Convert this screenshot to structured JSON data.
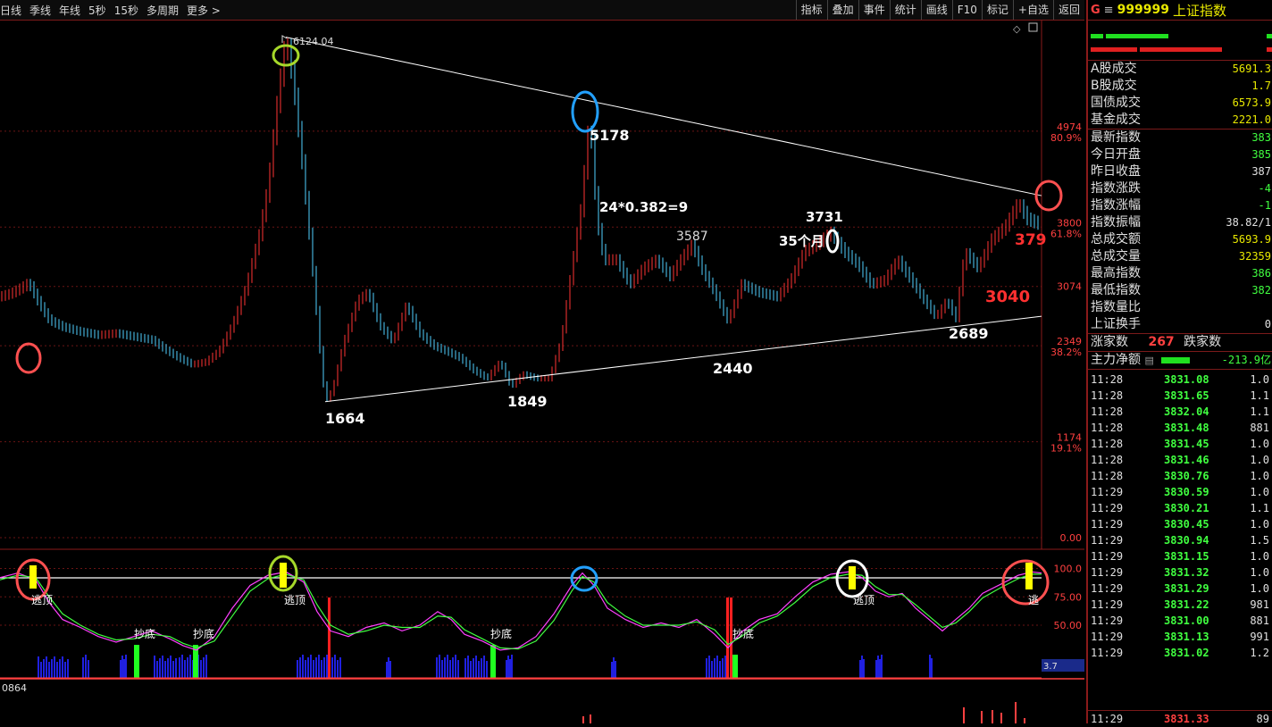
{
  "toolbar": {
    "periods": [
      "日线",
      "季线",
      "年线",
      "5秒",
      "15秒",
      "多周期",
      "更多 >"
    ],
    "actions": [
      "指标",
      "叠加",
      "事件",
      "统计",
      "画线",
      "F10",
      "标记",
      "+自选",
      "返回"
    ]
  },
  "colors": {
    "up": "#ff3333",
    "down": "#4fd0ff",
    "accent": "#ffff00",
    "panel_border": "#8a1a1a"
  },
  "chart_data": {
    "type": "line",
    "main": {
      "y_ticks": [
        {
          "value": "4974",
          "pct": "80.9%"
        },
        {
          "value": "3800",
          "pct": "61.8%"
        },
        {
          "value": "3074",
          "pct": ""
        },
        {
          "value": "2349",
          "pct": "38.2%"
        },
        {
          "value": "1174",
          "pct": "19.1%"
        },
        {
          "value": "0.00",
          "pct": ""
        }
      ],
      "annotations": [
        "6124.04",
        "5178",
        "24*0.382=9",
        "3731",
        "3587",
        "35个月",
        "379",
        "3040",
        "1664",
        "1849",
        "2440",
        "2689"
      ],
      "price_series": [
        [
          0,
          2950
        ],
        [
          12,
          2990
        ],
        [
          24,
          3060
        ],
        [
          32,
          3120
        ],
        [
          42,
          2900
        ],
        [
          55,
          2660
        ],
        [
          70,
          2580
        ],
        [
          90,
          2520
        ],
        [
          110,
          2480
        ],
        [
          130,
          2500
        ],
        [
          150,
          2460
        ],
        [
          170,
          2420
        ],
        [
          185,
          2300
        ],
        [
          200,
          2200
        ],
        [
          215,
          2120
        ],
        [
          230,
          2150
        ],
        [
          245,
          2280
        ],
        [
          260,
          2600
        ],
        [
          275,
          3050
        ],
        [
          290,
          3700
        ],
        [
          300,
          4300
        ],
        [
          310,
          5300
        ],
        [
          320,
          6124
        ],
        [
          328,
          5600
        ],
        [
          338,
          4600
        ],
        [
          348,
          3500
        ],
        [
          358,
          2300
        ],
        [
          364,
          1664
        ],
        [
          372,
          1800
        ],
        [
          385,
          2400
        ],
        [
          400,
          2900
        ],
        [
          412,
          3000
        ],
        [
          425,
          2600
        ],
        [
          440,
          2400
        ],
        [
          455,
          2850
        ],
        [
          470,
          2500
        ],
        [
          485,
          2350
        ],
        [
          500,
          2280
        ],
        [
          515,
          2200
        ],
        [
          530,
          2050
        ],
        [
          545,
          1950
        ],
        [
          560,
          2150
        ],
        [
          572,
          1849
        ],
        [
          585,
          2000
        ],
        [
          600,
          1950
        ],
        [
          615,
          1950
        ],
        [
          628,
          2400
        ],
        [
          640,
          3300
        ],
        [
          650,
          4000
        ],
        [
          660,
          5178
        ],
        [
          668,
          3900
        ],
        [
          676,
          3400
        ],
        [
          690,
          3400
        ],
        [
          705,
          3100
        ],
        [
          720,
          3300
        ],
        [
          735,
          3400
        ],
        [
          750,
          3200
        ],
        [
          765,
          3450
        ],
        [
          775,
          3587
        ],
        [
          785,
          3300
        ],
        [
          800,
          3000
        ],
        [
          815,
          2650
        ],
        [
          830,
          3100
        ],
        [
          850,
          3000
        ],
        [
          870,
          2950
        ],
        [
          885,
          3150
        ],
        [
          900,
          3500
        ],
        [
          915,
          3600
        ],
        [
          930,
          3731
        ],
        [
          945,
          3500
        ],
        [
          960,
          3350
        ],
        [
          975,
          3100
        ],
        [
          990,
          3150
        ],
        [
          1005,
          3400
        ],
        [
          1020,
          3150
        ],
        [
          1035,
          2900
        ],
        [
          1048,
          2700
        ],
        [
          1060,
          2900
        ],
        [
          1070,
          2689
        ],
        [
          1080,
          3500
        ],
        [
          1095,
          3300
        ],
        [
          1110,
          3650
        ],
        [
          1125,
          3800
        ],
        [
          1140,
          4100
        ],
        [
          1150,
          3900
        ],
        [
          1165,
          3830
        ]
      ],
      "trendlines": [
        {
          "label": "upper",
          "points": [
            [
              320,
              6124
            ],
            [
              1166,
              4185
            ]
          ]
        },
        {
          "label": "lower",
          "points": [
            [
              364,
              1664
            ],
            [
              1166,
              2709
            ]
          ]
        }
      ]
    },
    "indicator": {
      "y_ticks": [
        "100.0",
        "75.00",
        "50.00"
      ],
      "level_line": 92,
      "labels": [
        "逃顶",
        "逃顶",
        "逃顶",
        "逃",
        "抄底",
        "抄底",
        "抄底",
        "抄底"
      ],
      "readout": "3.7",
      "series": [
        {
          "color": "#ff40ff",
          "values": [
            [
              0,
              92
            ],
            [
              20,
              96
            ],
            [
              40,
              90
            ],
            [
              55,
              70
            ],
            [
              70,
              55
            ],
            [
              90,
              48
            ],
            [
              110,
              40
            ],
            [
              130,
              35
            ],
            [
              150,
              40
            ],
            [
              170,
              45
            ],
            [
              190,
              38
            ],
            [
              205,
              32
            ],
            [
              220,
              28
            ],
            [
              240,
              40
            ],
            [
              260,
              65
            ],
            [
              280,
              85
            ],
            [
              300,
              94
            ],
            [
              320,
              97
            ],
            [
              340,
              88
            ],
            [
              355,
              62
            ],
            [
              370,
              45
            ],
            [
              390,
              40
            ],
            [
              410,
              48
            ],
            [
              430,
              52
            ],
            [
              450,
              45
            ],
            [
              470,
              50
            ],
            [
              490,
              62
            ],
            [
              505,
              55
            ],
            [
              520,
              42
            ],
            [
              540,
              36
            ],
            [
              560,
              28
            ],
            [
              580,
              30
            ],
            [
              600,
              40
            ],
            [
              620,
              60
            ],
            [
              640,
              85
            ],
            [
              652,
              96
            ],
            [
              665,
              85
            ],
            [
              680,
              65
            ],
            [
              700,
              55
            ],
            [
              720,
              48
            ],
            [
              740,
              52
            ],
            [
              760,
              48
            ],
            [
              780,
              55
            ],
            [
              800,
              42
            ],
            [
              815,
              30
            ],
            [
              830,
              44
            ],
            [
              850,
              55
            ],
            [
              870,
              60
            ],
            [
              890,
              75
            ],
            [
              910,
              88
            ],
            [
              930,
              95
            ],
            [
              950,
              97
            ],
            [
              965,
              92
            ],
            [
              980,
              80
            ],
            [
              995,
              75
            ],
            [
              1010,
              78
            ],
            [
              1025,
              65
            ],
            [
              1040,
              55
            ],
            [
              1055,
              45
            ],
            [
              1070,
              55
            ],
            [
              1085,
              65
            ],
            [
              1100,
              78
            ],
            [
              1120,
              86
            ],
            [
              1140,
              94
            ],
            [
              1155,
              97
            ],
            [
              1166,
              96
            ]
          ]
        },
        {
          "color": "#40ff40",
          "values": [
            [
              0,
              90
            ],
            [
              20,
              94
            ],
            [
              40,
              92
            ],
            [
              55,
              75
            ],
            [
              70,
              60
            ],
            [
              90,
              50
            ],
            [
              110,
              42
            ],
            [
              130,
              37
            ],
            [
              150,
              38
            ],
            [
              170,
              42
            ],
            [
              190,
              40
            ],
            [
              205,
              34
            ],
            [
              220,
              30
            ],
            [
              240,
              36
            ],
            [
              260,
              58
            ],
            [
              280,
              80
            ],
            [
              300,
              91
            ],
            [
              320,
              95
            ],
            [
              340,
              90
            ],
            [
              355,
              68
            ],
            [
              370,
              50
            ],
            [
              390,
              42
            ],
            [
              410,
              45
            ],
            [
              430,
              50
            ],
            [
              450,
              48
            ],
            [
              470,
              48
            ],
            [
              490,
              58
            ],
            [
              505,
              57
            ],
            [
              520,
              46
            ],
            [
              540,
              38
            ],
            [
              560,
              30
            ],
            [
              580,
              29
            ],
            [
              600,
              36
            ],
            [
              620,
              54
            ],
            [
              640,
              80
            ],
            [
              652,
              93
            ],
            [
              665,
              88
            ],
            [
              680,
              70
            ],
            [
              700,
              58
            ],
            [
              720,
              50
            ],
            [
              740,
              50
            ],
            [
              760,
              50
            ],
            [
              780,
              53
            ],
            [
              800,
              46
            ],
            [
              815,
              33
            ],
            [
              830,
              40
            ],
            [
              850,
              52
            ],
            [
              870,
              58
            ],
            [
              890,
              70
            ],
            [
              910,
              84
            ],
            [
              930,
              92
            ],
            [
              950,
              95
            ],
            [
              965,
              94
            ],
            [
              980,
              84
            ],
            [
              995,
              77
            ],
            [
              1010,
              77
            ],
            [
              1025,
              68
            ],
            [
              1040,
              58
            ],
            [
              1055,
              48
            ],
            [
              1070,
              52
            ],
            [
              1085,
              62
            ],
            [
              1100,
              74
            ],
            [
              1120,
              83
            ],
            [
              1140,
              91
            ],
            [
              1155,
              95
            ],
            [
              1166,
              95
            ]
          ]
        }
      ]
    },
    "lower_readout": "0864"
  },
  "quote_panel": {
    "code_letter": "G",
    "code": "999999",
    "name": "上证指数",
    "stats": [
      {
        "label": "A股成交",
        "value": "5691.3",
        "color": "#e8e800"
      },
      {
        "label": "B股成交",
        "value": "1.7",
        "color": "#e8e800"
      },
      {
        "label": "国债成交",
        "value": "6573.9",
        "color": "#e8e800"
      },
      {
        "label": "基金成交",
        "value": "2221.0",
        "color": "#e8e800"
      }
    ],
    "indices": [
      {
        "label": "最新指数",
        "value": "383",
        "color": "#40ff40"
      },
      {
        "label": "今日开盘",
        "value": "385",
        "color": "#40ff40"
      },
      {
        "label": "昨日收盘",
        "value": "387",
        "color": "#e0e0e0"
      },
      {
        "label": "指数涨跌",
        "value": "-4",
        "color": "#40ff40"
      },
      {
        "label": "指数涨幅",
        "value": "-1",
        "color": "#40ff40"
      },
      {
        "label": "指数振幅",
        "value": "38.82/1",
        "color": "#e0e0e0"
      },
      {
        "label": "总成交额",
        "value": "5693.9",
        "color": "#e8e800"
      },
      {
        "label": "总成交量",
        "value": "32359",
        "color": "#e8e800"
      },
      {
        "label": "最高指数",
        "value": "386",
        "color": "#40ff40"
      },
      {
        "label": "最低指数",
        "value": "382",
        "color": "#40ff40"
      },
      {
        "label": "指数量比",
        "value": "",
        "color": "#e0e0e0"
      },
      {
        "label": "上证换手",
        "value": "0",
        "color": "#e0e0e0"
      }
    ],
    "breadth": {
      "up_label": "涨家数",
      "up_value": "267",
      "down_label": "跌家数"
    },
    "main_flow": {
      "label": "主力净额",
      "value": "-213.9亿"
    },
    "ticks": [
      {
        "time": "11:28",
        "price": "3831.08",
        "vol": "1.0"
      },
      {
        "time": "11:28",
        "price": "3831.65",
        "vol": "1.1"
      },
      {
        "time": "11:28",
        "price": "3832.04",
        "vol": "1.1"
      },
      {
        "time": "11:28",
        "price": "3831.48",
        "vol": "881"
      },
      {
        "time": "11:28",
        "price": "3831.45",
        "vol": "1.0"
      },
      {
        "time": "11:28",
        "price": "3831.46",
        "vol": "1.0"
      },
      {
        "time": "11:28",
        "price": "3830.76",
        "vol": "1.0"
      },
      {
        "time": "11:29",
        "price": "3830.59",
        "vol": "1.0"
      },
      {
        "time": "11:29",
        "price": "3830.21",
        "vol": "1.1"
      },
      {
        "time": "11:29",
        "price": "3830.45",
        "vol": "1.0"
      },
      {
        "time": "11:29",
        "price": "3830.94",
        "vol": "1.5"
      },
      {
        "time": "11:29",
        "price": "3831.15",
        "vol": "1.0"
      },
      {
        "time": "11:29",
        "price": "3831.32",
        "vol": "1.0"
      },
      {
        "time": "11:29",
        "price": "3831.29",
        "vol": "1.0"
      },
      {
        "time": "11:29",
        "price": "3831.22",
        "vol": "981"
      },
      {
        "time": "11:29",
        "price": "3831.00",
        "vol": "881"
      },
      {
        "time": "11:29",
        "price": "3831.13",
        "vol": "991"
      },
      {
        "time": "11:29",
        "price": "3831.02",
        "vol": "1.2"
      }
    ],
    "last_tick": {
      "time": "11:29",
      "price": "3831.33",
      "vol": "89"
    }
  }
}
